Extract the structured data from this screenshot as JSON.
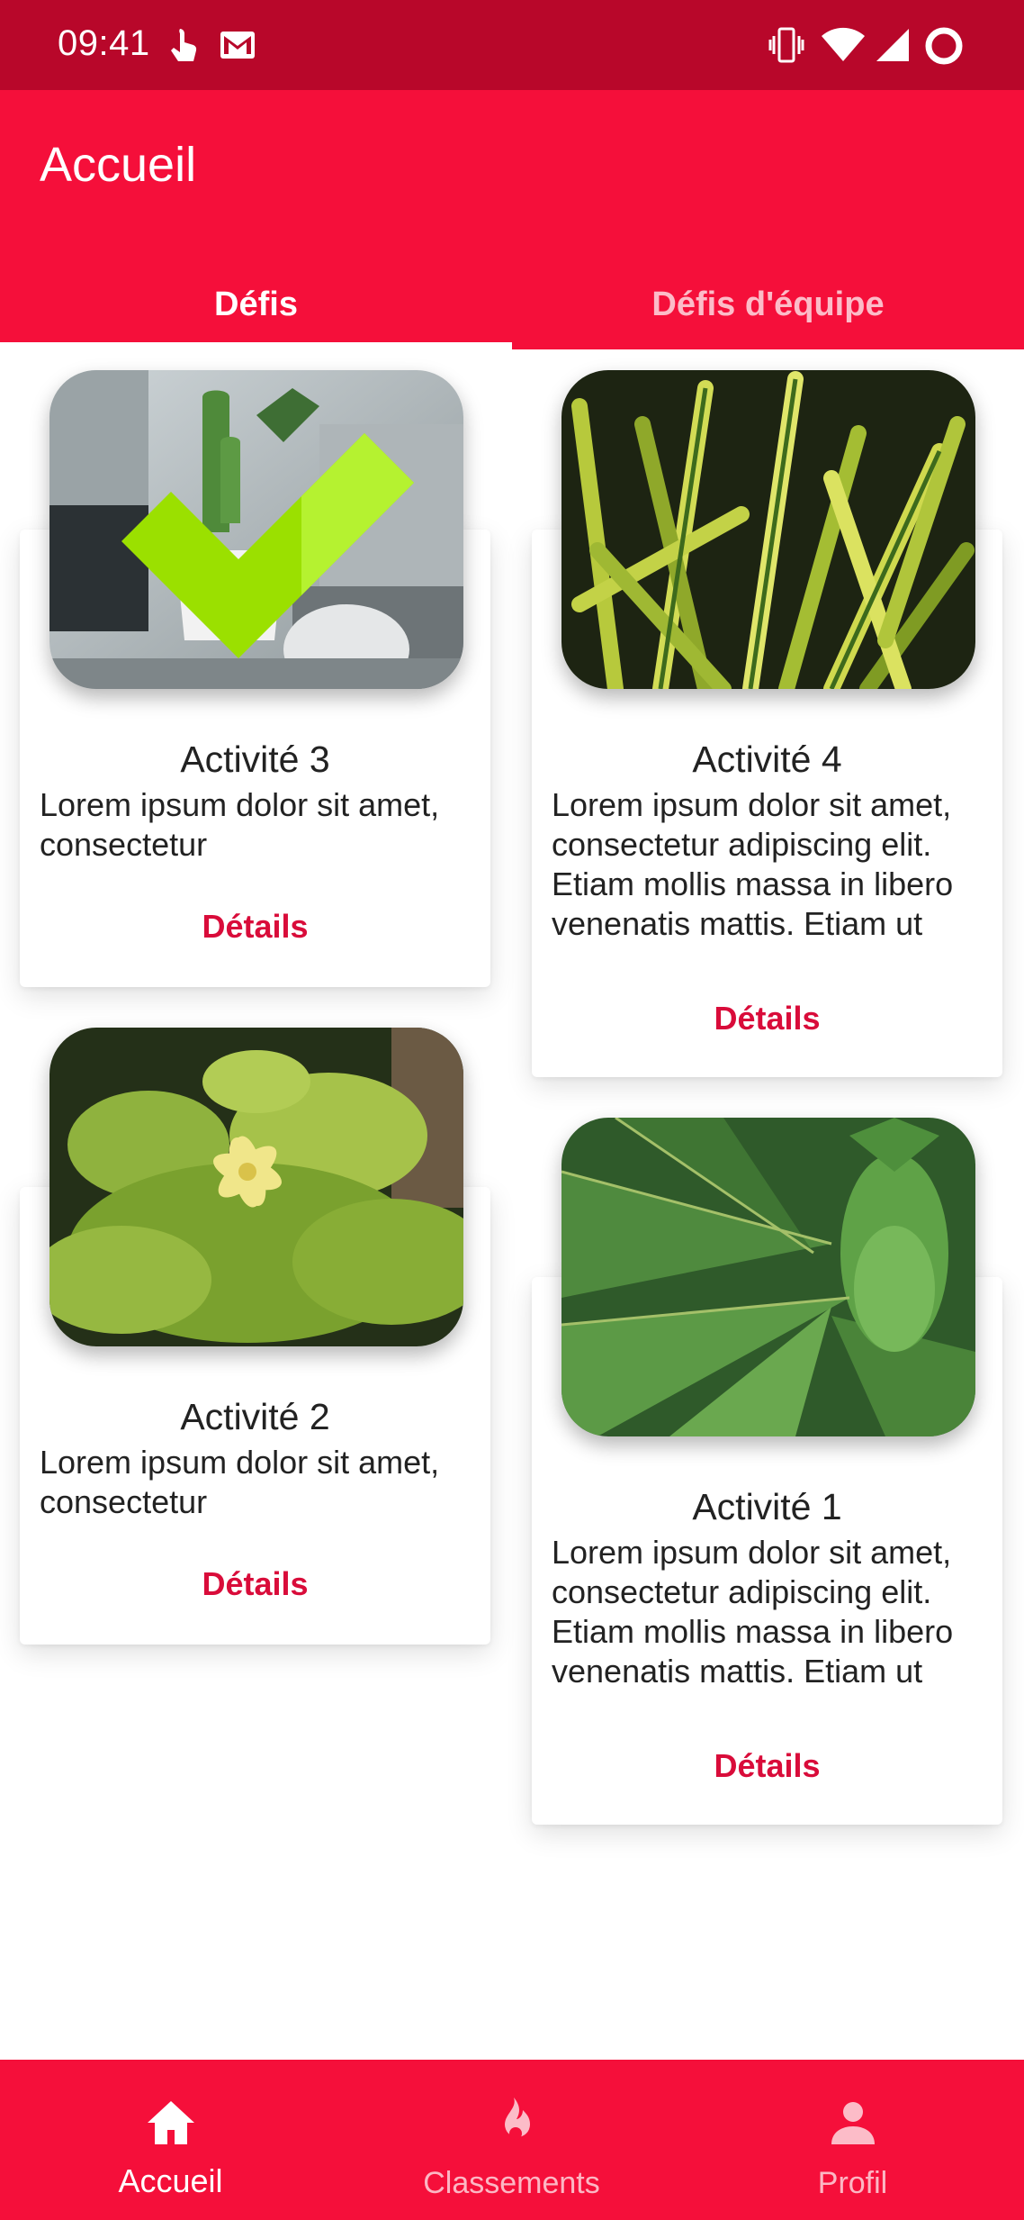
{
  "status_bar": {
    "time": "09:41",
    "icons": [
      "touch-icon",
      "gmail-icon",
      "vibrate-icon",
      "wifi-icon",
      "signal-icon",
      "data-saver-icon"
    ]
  },
  "app_bar": {
    "title": "Accueil",
    "tabs": [
      {
        "label": "Défis",
        "active": true
      },
      {
        "label": "Défis d'équipe",
        "active": false
      }
    ]
  },
  "activities": [
    {
      "title": "Activité 3",
      "description": "Lorem ipsum dolor sit amet, consectetur",
      "button": "Détails",
      "completed": true,
      "image": "potted-cactus-photo"
    },
    {
      "title": "Activité 4",
      "description": "Lorem ipsum dolor sit amet, consectetur adipiscing elit. Etiam mollis massa in libero venenatis mattis. Etiam ut turpis nibh.",
      "button": "Détails",
      "completed": false,
      "image": "yucca-leaves-photo"
    },
    {
      "title": "Activité 2",
      "description": "Lorem ipsum dolor sit amet, consectetur",
      "button": "Détails",
      "completed": false,
      "image": "flowering-plant-photo"
    },
    {
      "title": "Activité 1",
      "description": "Lorem ipsum dolor sit amet, consectetur adipiscing elit. Etiam mollis massa in libero venenatis mattis. Etiam ut turpis nibh.",
      "button": "Détails",
      "completed": false,
      "image": "agave-photo"
    }
  ],
  "bottom_nav": {
    "items": [
      {
        "label": "Accueil",
        "icon": "home-icon",
        "active": true
      },
      {
        "label": "Classements",
        "icon": "flame-icon",
        "active": false
      },
      {
        "label": "Profil",
        "icon": "person-icon",
        "active": false
      }
    ]
  },
  "colors": {
    "primary": "#f50f3a",
    "status_bar": "#b8072a",
    "accent_text": "#d90c3a",
    "check": "#9be000"
  }
}
